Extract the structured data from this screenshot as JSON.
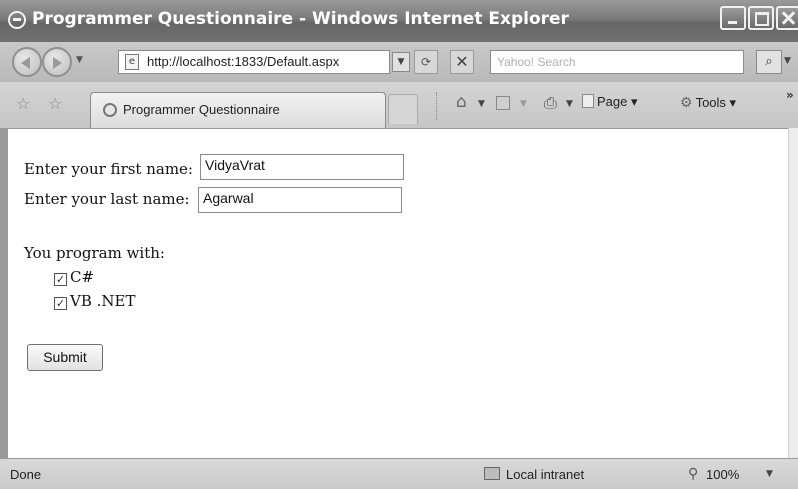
{
  "window": {
    "title": "Programmer Questionnaire - Windows Internet Explorer"
  },
  "address_bar": {
    "url": "http://localhost:1833/Default.aspx",
    "search_placeholder": "Yahoo! Search"
  },
  "tabs": [
    {
      "label": "Programmer Questionnaire"
    }
  ],
  "command_bar": {
    "page_label": "Page",
    "tools_label": "Tools",
    "overflow_label": "»"
  },
  "form": {
    "first_name_label": "Enter your first name:",
    "first_name_value": "VidyaVrat",
    "last_name_label": "Enter your last name:",
    "last_name_value": "Agarwal",
    "program_with_label": "You program with:",
    "options": [
      {
        "label": "C#",
        "checked": true
      },
      {
        "label": "VB .NET",
        "checked": true
      }
    ],
    "submit_label": "Submit"
  },
  "status_bar": {
    "status": "Done",
    "zone": "Local intranet",
    "zoom": "100%"
  },
  "icons": [
    "ie-icon",
    "back-icon",
    "forward-icon",
    "page-icon",
    "refresh-icon",
    "stop-icon",
    "search-icon",
    "favorites-star-icon",
    "add-favorites-icon",
    "home-icon",
    "feeds-icon",
    "print-icon",
    "tools-gear-icon",
    "zoom-icon",
    "zone-icon"
  ]
}
